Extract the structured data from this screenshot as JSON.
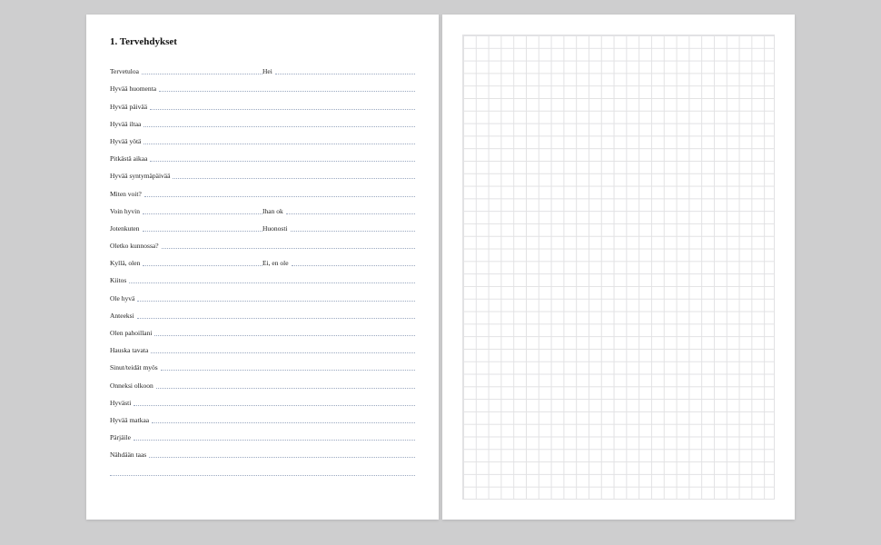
{
  "heading": "1. Tervehdykset",
  "rows": [
    {
      "cols": [
        "Tervetuloa",
        "Hei"
      ]
    },
    {
      "cols": [
        "Hyvää huomenta"
      ]
    },
    {
      "cols": [
        "Hyvää päivää"
      ]
    },
    {
      "cols": [
        "Hyvää iltaa"
      ]
    },
    {
      "cols": [
        "Hyvää yötä"
      ]
    },
    {
      "cols": [
        "Pitkästä aikaa"
      ]
    },
    {
      "cols": [
        "Hyvää syntymäpäivää"
      ]
    },
    {
      "cols": [
        "Miten voit?"
      ]
    },
    {
      "cols": [
        "Voin hyvin",
        "Ihan ok"
      ]
    },
    {
      "cols": [
        "Jotenkuten",
        "Huonosti"
      ]
    },
    {
      "cols": [
        "Oletko kunnossa?"
      ]
    },
    {
      "cols": [
        "Kyllä, olen",
        "Ei, en ole"
      ]
    },
    {
      "cols": [
        "Kiitos"
      ]
    },
    {
      "cols": [
        "Ole hyvä"
      ]
    },
    {
      "cols": [
        "Anteeksi"
      ]
    },
    {
      "cols": [
        "Olen pahoillani"
      ]
    },
    {
      "cols": [
        "Hauska tavata"
      ]
    },
    {
      "cols": [
        "Sinut/teidät myös"
      ]
    },
    {
      "cols": [
        "Onneksi olkoon"
      ]
    },
    {
      "cols": [
        "Hyvästi"
      ]
    },
    {
      "cols": [
        "Hyvää matkaa"
      ]
    },
    {
      "cols": [
        "Pärjäile"
      ]
    },
    {
      "cols": [
        "Nähdään taas"
      ]
    },
    {
      "cols": [
        ""
      ]
    }
  ]
}
